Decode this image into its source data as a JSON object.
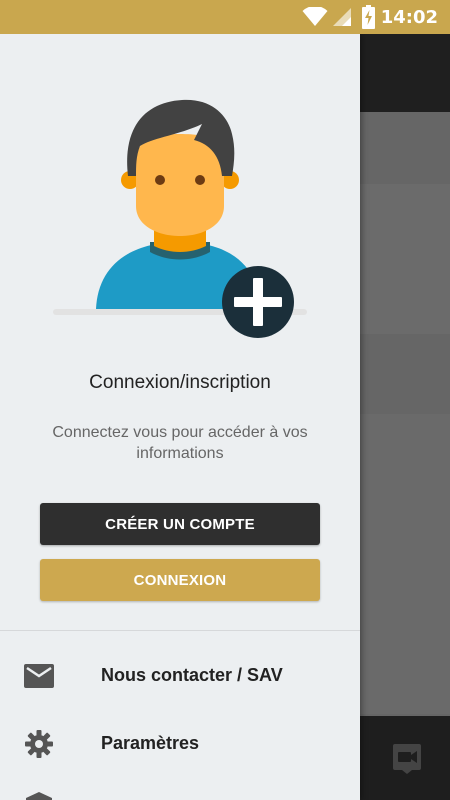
{
  "status_bar": {
    "time": "14:02",
    "icons": [
      "wifi-icon",
      "signal-icon",
      "battery-charging-icon"
    ]
  },
  "drawer": {
    "title": "Connexion/inscription",
    "subtitle": "Connectez vous pour accéder à vos informations",
    "create_account_label": "CRÉER UN COMPTE",
    "login_label": "CONNEXION",
    "menu": [
      {
        "label": "Nous contacter / SAV",
        "icon": "mail-icon"
      },
      {
        "label": "Paramètres",
        "icon": "gear-icon"
      }
    ]
  },
  "colors": {
    "accent": "#c9a74e",
    "dark_button": "#2f2f2f",
    "drawer_bg": "#eceff1"
  }
}
